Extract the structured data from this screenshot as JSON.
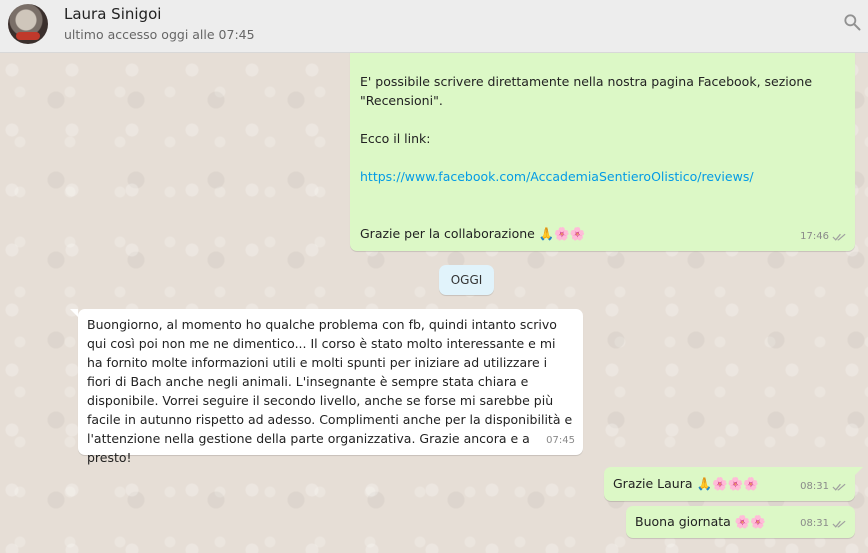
{
  "header": {
    "contact_name": "Laura Sinigoi",
    "last_seen": "ultimo accesso oggi alle 07:45"
  },
  "messages": [
    {
      "direction": "outgoing",
      "lines": [
        "E' possibile scrivere direttamente nella nostra pagina Facebook, sezione",
        "\"Recensioni\".",
        "",
        "Ecco il link:",
        "",
        "https://www.facebook.com/AccademiaSentieroOlistico/reviews/",
        "",
        "",
        "Grazie per la collaborazione 🙏🌸🌸"
      ],
      "time": "17:46",
      "status": "read"
    },
    {
      "direction": "incoming",
      "text": "Buongiorno, al momento ho qualche problema con fb, quindi intanto scrivo qui così poi non me ne dimentico... Il corso è stato molto interessante e mi ha fornito molte informazioni utili e molti spunti per iniziare ad utilizzare i fiori di Bach anche negli animali. L'insegnante è sempre stata chiara e disponibile. Vorrei seguire il secondo livello, anche se forse mi sarebbe più facile in autunno rispetto ad adesso. Complimenti anche per la disponibilità e l'attenzione nella gestione della parte organizzativa. Grazie ancora e a presto!",
      "time": "07:45"
    },
    {
      "direction": "outgoing",
      "text": "Grazie Laura 🙏🌸🌸🌸",
      "time": "08:31",
      "status": "read"
    },
    {
      "direction": "outgoing",
      "text": "Buona giornata 🌸🌸",
      "time": "08:31",
      "status": "read"
    }
  ],
  "date_divider": "OGGI",
  "colors": {
    "outgoing_bubble": "#dcf8c6",
    "incoming_bubble": "#ffffff",
    "link": "#039be5",
    "date_pill": "#e1f3fb"
  }
}
